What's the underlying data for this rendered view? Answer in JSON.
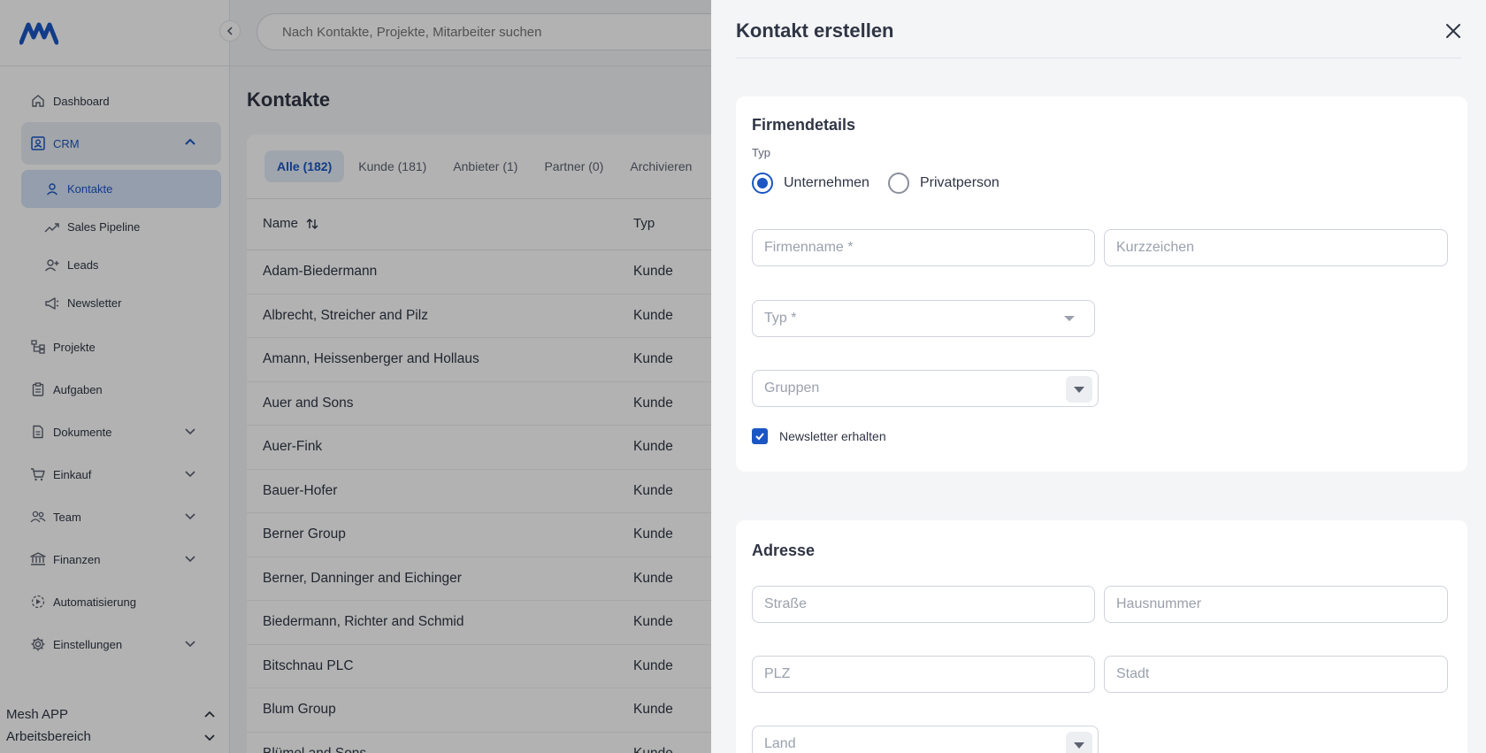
{
  "sidebar": {
    "nav": [
      {
        "label": "Dashboard",
        "icon": "home-icon"
      },
      {
        "label": "CRM",
        "icon": "contact-card-icon"
      },
      {
        "label": "Projekte",
        "icon": "project-tree-icon"
      },
      {
        "label": "Aufgaben",
        "icon": "clipboard-icon"
      },
      {
        "label": "Dokumente",
        "icon": "document-icon"
      },
      {
        "label": "Einkauf",
        "icon": "cart-icon"
      },
      {
        "label": "Team",
        "icon": "team-icon"
      },
      {
        "label": "Finanzen",
        "icon": "bank-icon"
      },
      {
        "label": "Automatisierung",
        "icon": "automation-icon"
      },
      {
        "label": "Einstellungen",
        "icon": "gear-icon"
      }
    ],
    "crm_sub": [
      {
        "label": "Kontakte",
        "icon": "person-icon"
      },
      {
        "label": "Sales Pipeline",
        "icon": "trend-icon"
      },
      {
        "label": "Leads",
        "icon": "add-person-icon"
      },
      {
        "label": "Newsletter",
        "icon": "megaphone-icon"
      }
    ],
    "app_name": "Mesh APP",
    "workspace": "Arbeitsbereich"
  },
  "search": {
    "placeholder": "Nach Kontakte, Projekte, Mitarbeiter suchen"
  },
  "main": {
    "title": "Kontakte",
    "tabs": [
      "Alle (182)",
      "Kunde (181)",
      "Anbieter (1)",
      "Partner (0)",
      "Archivieren"
    ],
    "columns": {
      "name": "Name",
      "typ": "Typ"
    },
    "rows": [
      {
        "name": "Adam-Biedermann",
        "typ": "Kunde"
      },
      {
        "name": "Albrecht, Streicher and Pilz",
        "typ": "Kunde"
      },
      {
        "name": "Amann, Heissenberger and Hollaus",
        "typ": "Kunde"
      },
      {
        "name": "Auer and Sons",
        "typ": "Kunde"
      },
      {
        "name": "Auer-Fink",
        "typ": "Kunde"
      },
      {
        "name": "Bauer-Hofer",
        "typ": "Kunde"
      },
      {
        "name": "Berner Group",
        "typ": "Kunde"
      },
      {
        "name": "Berner, Danninger and Eichinger",
        "typ": "Kunde"
      },
      {
        "name": "Biedermann, Richter and Schmid",
        "typ": "Kunde"
      },
      {
        "name": "Bitschnau PLC",
        "typ": "Kunde"
      },
      {
        "name": "Blum Group",
        "typ": "Kunde"
      },
      {
        "name": "Blümel and Sons",
        "typ": "Kunde"
      }
    ]
  },
  "drawer": {
    "title": "Kontakt erstellen",
    "firmendetails": {
      "title": "Firmendetails",
      "typ_label": "Typ",
      "radio_company": "Unternehmen",
      "radio_private": "Privatperson",
      "firmenname_placeholder": "Firmenname *",
      "kurzzeichen_placeholder": "Kurzzeichen",
      "typ_select": "Typ *",
      "gruppen_select": "Gruppen",
      "newsletter_label": "Newsletter erhalten"
    },
    "adresse": {
      "title": "Adresse",
      "strasse_placeholder": "Straße",
      "hausnummer_placeholder": "Hausnummer",
      "plz_placeholder": "PLZ",
      "stadt_placeholder": "Stadt",
      "land_select": "Land"
    }
  },
  "colors": {
    "accent": "#1a56c4",
    "text": "#2f3544",
    "muted": "#9aa0ac"
  }
}
